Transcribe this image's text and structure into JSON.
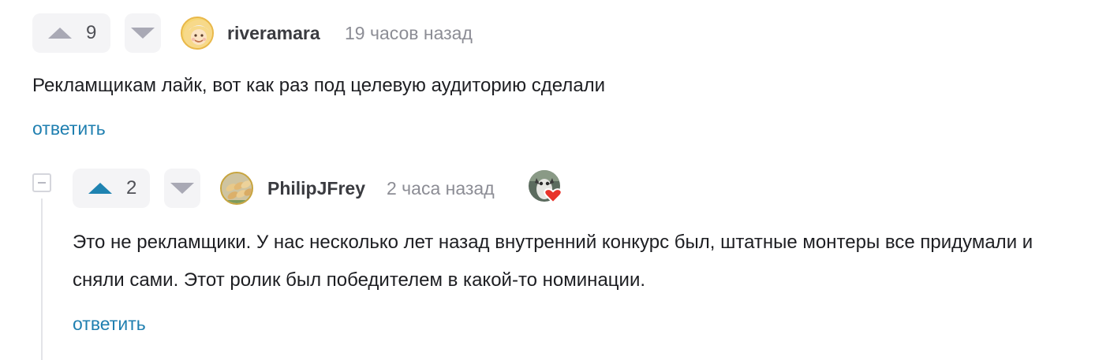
{
  "comments": [
    {
      "rating": "9",
      "author": "riveramara",
      "time": "19 часов назад",
      "text": "Рекламщикам лайк, вот как раз под целевую аудиторию сделали",
      "reply_label": "ответить",
      "avatar_icon": "cartoon-face-avatar"
    },
    {
      "rating": "2",
      "author": "PhilipJFrey",
      "time": "2 часа назад",
      "text": "Это не рекламщики. У нас несколько лет назад внутренний конкурс был, штатные монтеры все придумали и сняли сами. Этот ролик был победителем в какой-то номинации.",
      "reply_label": "ответить",
      "avatar_icon": "food-photo-avatar",
      "badge_icon": "heart-award-icon"
    }
  ],
  "colors": {
    "accent": "#1f83b1",
    "link": "#1f7fb0",
    "vote_bg": "#f4f4f6",
    "muted": "#8c8d95"
  }
}
